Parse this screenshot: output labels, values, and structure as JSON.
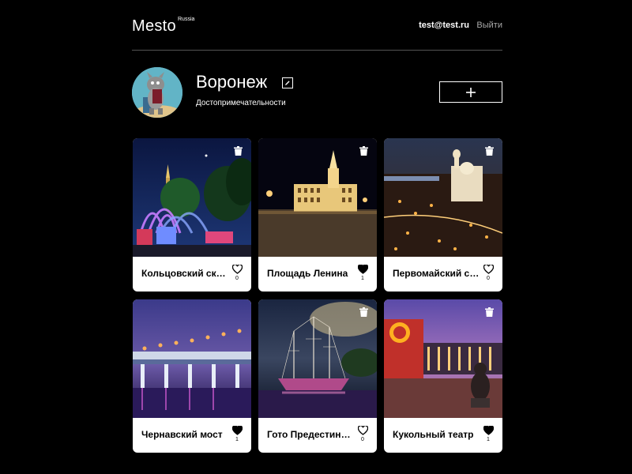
{
  "header": {
    "logo": "Mesto",
    "logo_sup": "Russia",
    "email": "test@test.ru",
    "logout": "Выйти"
  },
  "profile": {
    "name": "Воронеж",
    "about": "Достопримечательности"
  },
  "cards": [
    {
      "title": "Кольцовский сквер",
      "likes": "0",
      "liked": false
    },
    {
      "title": "Площадь Ленина",
      "likes": "1",
      "liked": true
    },
    {
      "title": "Первомайский сад",
      "likes": "0",
      "liked": false
    },
    {
      "title": "Чернавский мост",
      "likes": "1",
      "liked": true
    },
    {
      "title": "Гото Предестинация",
      "likes": "0",
      "liked": false
    },
    {
      "title": "Кукольный театр",
      "likes": "1",
      "liked": true
    }
  ],
  "icons": {
    "edit": "pencil-icon",
    "add": "plus-icon",
    "delete": "trash-icon",
    "like": "heart-icon"
  },
  "colors": {
    "background": "#000000",
    "card": "#ffffff",
    "muted": "#a9a9a9",
    "divider": "#545454"
  }
}
